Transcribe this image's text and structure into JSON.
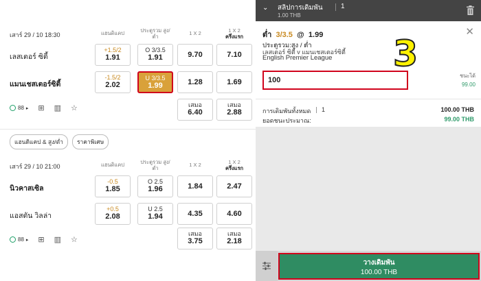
{
  "left": {
    "col_headers": {
      "handicap": "แฮนดิแคป",
      "over_under": [
        "ประตูรวม สูง/",
        "ต่ำ"
      ],
      "one_x_two": "1 X 2",
      "one_x_two_first_half": [
        "1 X 2",
        "ครึ่งแรก"
      ]
    },
    "matches": [
      {
        "date": "เสาร์ 29 / 10 18:30",
        "teams": [
          {
            "name": "เลสเตอร์ ซิตี้",
            "hcap_line": "+1.5/2",
            "hcap_odd": "1.91",
            "ou_line": "O 3/3.5",
            "ou_odd": "1.91",
            "x12": "9.70",
            "x12_half": "7.10"
          },
          {
            "name": "แมนเชสเตอร์ซิตี้",
            "hcap_line": "-1.5/2",
            "hcap_odd": "2.02",
            "ou_line": "U 3/3.5",
            "ou_odd": "1.99",
            "x12": "1.28",
            "x12_half": "1.69"
          }
        ],
        "draw_label": "เสมอ",
        "draw": "6.40",
        "draw_half": "2.88",
        "live_count": "88"
      },
      {
        "date": "เสาร์ 29 / 10 21:00",
        "teams": [
          {
            "name": "นิวคาสเซิล",
            "hcap_line": "-0.5",
            "hcap_odd": "1.85",
            "ou_line": "O 2.5",
            "ou_odd": "1.96",
            "x12": "1.84",
            "x12_half": "2.47"
          },
          {
            "name": "แอสตัน วิลล่า",
            "hcap_line": "+0.5",
            "hcap_odd": "2.08",
            "ou_line": "U 2.5",
            "ou_odd": "1.94",
            "x12": "4.35",
            "x12_half": "4.60"
          }
        ],
        "draw_label": "เสมอ",
        "draw": "3.75",
        "draw_half": "2.18",
        "live_count": "88"
      }
    ],
    "pills": [
      "แฮนดิแคป & สูง/ต่ำ",
      "ราคาพิเศษ"
    ]
  },
  "slip": {
    "title": "สลิปการเดิมพัน",
    "count": "1",
    "sub": "1.00 THB",
    "selection_prefix": "ต่ำ",
    "selection_handicap": "3/3.5",
    "selection_at": "@",
    "selection_odd": "1.99",
    "market": "ประตูรวม:สูง / ต่ำ",
    "event": "เลสเตอร์ ซิตี้ v แมนเชสเตอร์ซิตี้",
    "league": "English Premier League",
    "stake_value": "100",
    "win_label": "ชนะได้",
    "win_value": "99.00",
    "annotation": "3",
    "total_stake_label": "การเดิมพันทั้งหมด",
    "total_stake_count": "1",
    "total_stake_value": "100.00 THB",
    "est_win_label": "ยอดชนะประมาณ:",
    "est_win_value": "99.00 THB",
    "place_bet_label": "วางเดิมพัน",
    "place_bet_amount": "100.00 THB"
  },
  "colors": {
    "accent_green": "#2f8c62",
    "highlight_red": "#d0021b",
    "selected_gold": "#d9a13a",
    "handicap_orange": "#c8891f"
  }
}
